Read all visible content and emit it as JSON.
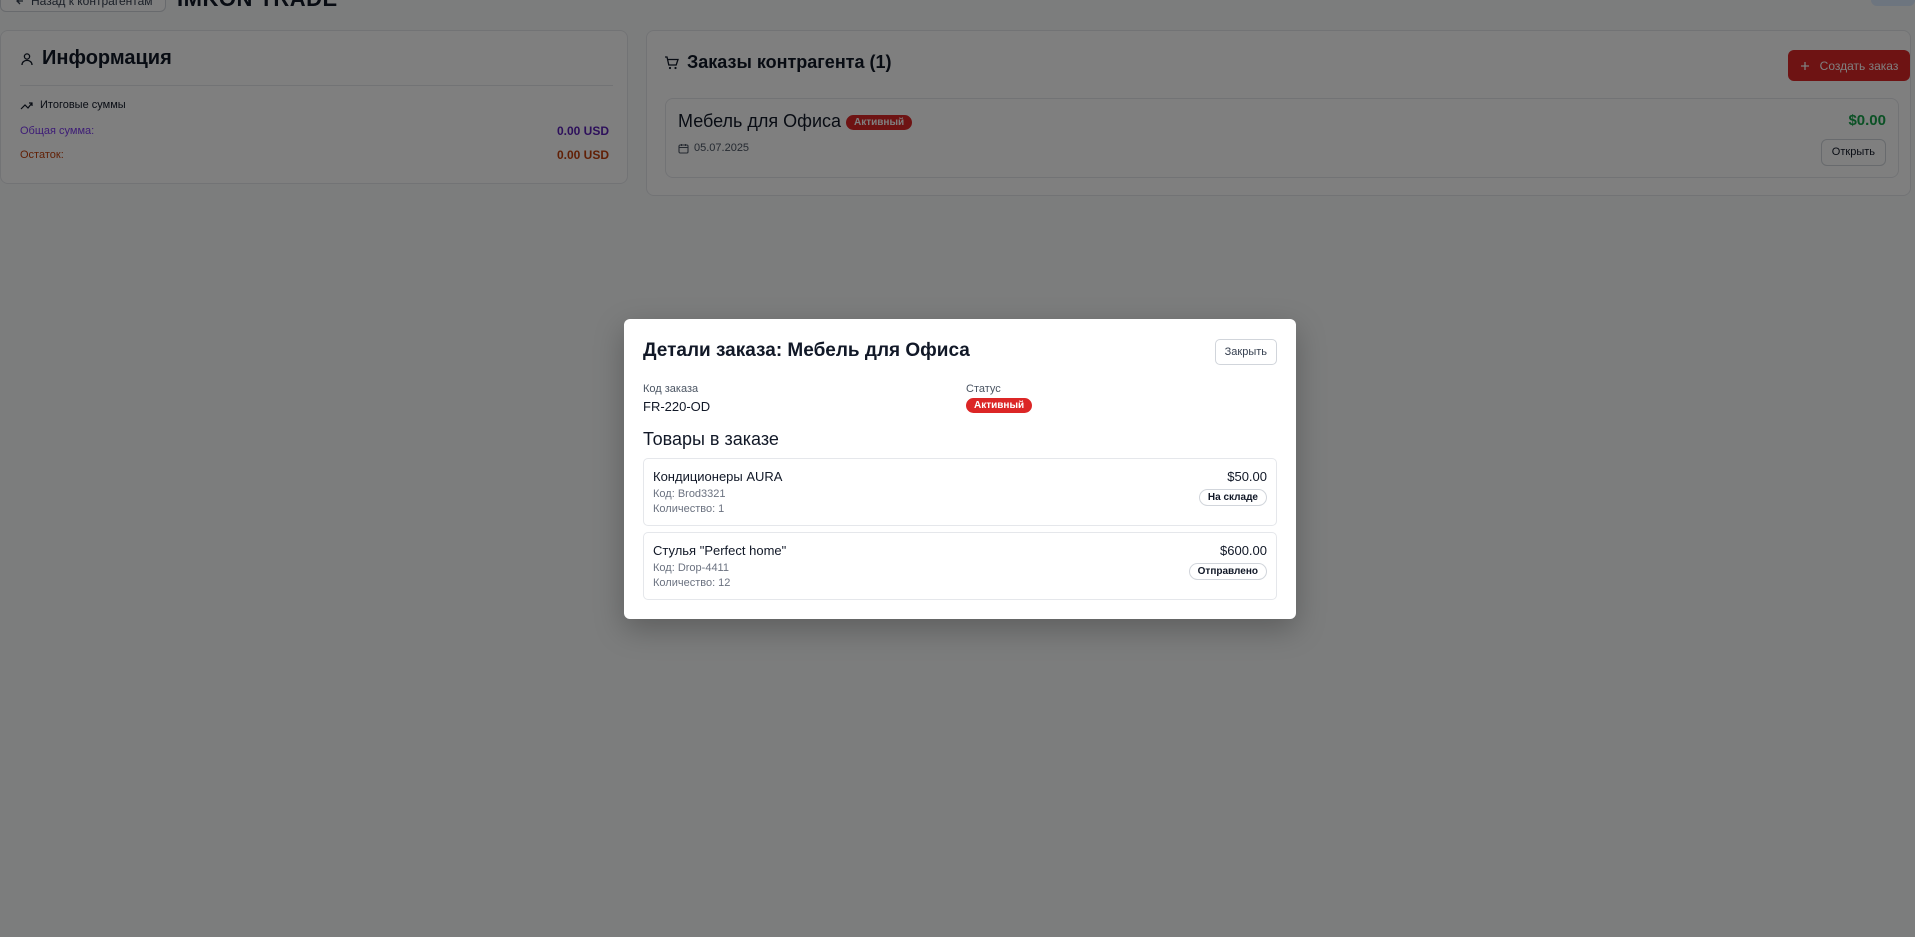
{
  "topbar": {
    "back_label": "Назад к контрагентам",
    "company_name": "IMKON TRADE"
  },
  "info": {
    "title": "Информация",
    "totals_title": "Итоговые суммы",
    "total_label": "Общая сумма:",
    "total_value": "0.00 USD",
    "rest_label": "Остаток:",
    "rest_value": "0.00 USD"
  },
  "orders": {
    "title": "Заказы контрагента (1)",
    "create_label": "Создать заказ",
    "items": [
      {
        "name": "Мебель для Офиса",
        "status": "Активный",
        "date": "05.07.2025",
        "amount": "$0.00",
        "open_label": "Открыть"
      }
    ]
  },
  "modal": {
    "title": "Детали заказа: Мебель для Офиса",
    "close_label": "Закрыть",
    "code_label": "Код заказа",
    "code_value": "FR-220-OD",
    "status_label": "Статус",
    "status_value": "Активный",
    "items_title": "Товары в заказе",
    "items": [
      {
        "name": "Кондиционеры AURA",
        "code": "Код: Brod3321",
        "qty": "Количество: 1",
        "price": "$50.00",
        "status": "На складе"
      },
      {
        "name": "Стулья \"Perfect home\"",
        "code": "Код: Drop-4411",
        "qty": "Количество: 12",
        "price": "$600.00",
        "status": "Отправлено"
      }
    ]
  },
  "colors": {
    "accent_red": "#dc2626",
    "total_purple": "#5b21b6",
    "rest_orange": "#c2410c",
    "amount_green": "#16a34a",
    "overlay": "rgba(0,0,0,0.5)"
  }
}
